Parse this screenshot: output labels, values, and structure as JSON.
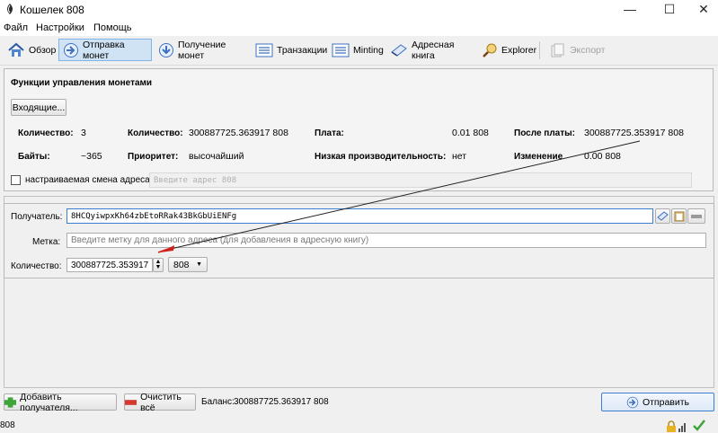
{
  "window": {
    "title": "Кошелек 808",
    "controls": [
      "—",
      "☐",
      "✕"
    ]
  },
  "menu": [
    "Файл",
    "Настройки",
    "Помощь"
  ],
  "toolbar": {
    "items": [
      {
        "label": "Обзор"
      },
      {
        "label": "Отправка монет",
        "active": true
      },
      {
        "label": "Получение монет"
      },
      {
        "label": "Транзакции"
      },
      {
        "label": "Minting"
      },
      {
        "label": "Адресная книга"
      },
      {
        "label": "Explorer"
      },
      {
        "label": "Экспорт",
        "disabled": true
      }
    ]
  },
  "coin_control": {
    "title": "Функции управления монетами",
    "inputs_button": "Входящие...",
    "quantity_label": "Количество:",
    "quantity_value": "3",
    "amount_label": "Количество:",
    "amount_value": "300887725.363917 808",
    "fee_label": "Плата:",
    "fee_value": "0.01 808",
    "after_fee_label": "После платы:",
    "after_fee_value": "300887725.353917 808",
    "bytes_label": "Байты:",
    "bytes_value": "~365",
    "priority_label": "Приоритет:",
    "priority_value": "высочайший",
    "low_output_label": "Низкая производительность:",
    "low_output_value": "нет",
    "change_label": "Изменение",
    "change_value": "0.00 808",
    "custom_change_label": "настраиваемая смена адреса",
    "custom_change_placeholder": "Введите адрес 808"
  },
  "recipient": {
    "payto_label": "Получатель:",
    "payto_value": "8HCQyiwpxKh64zbEtoRRak43BkGbUiENFg",
    "label_label": "Метка:",
    "label_placeholder": "Введите метку для данного адреса (для добавления в адресную книгу)",
    "amount_label": "Количество:",
    "amount_value": "300887725.353917",
    "unit": "808"
  },
  "bottom": {
    "add_recipient": "Добавить получателя...",
    "clear_all": "Очистить всё",
    "balance_label": "Баланс:",
    "balance_value": "300887725.363917 808",
    "send": "Отправить"
  },
  "statusbar": {
    "unit": "808"
  },
  "colors": {
    "accent": "#7eb4ea",
    "arrow_annotation": "#222222",
    "arrow_head": "#d0201a"
  }
}
